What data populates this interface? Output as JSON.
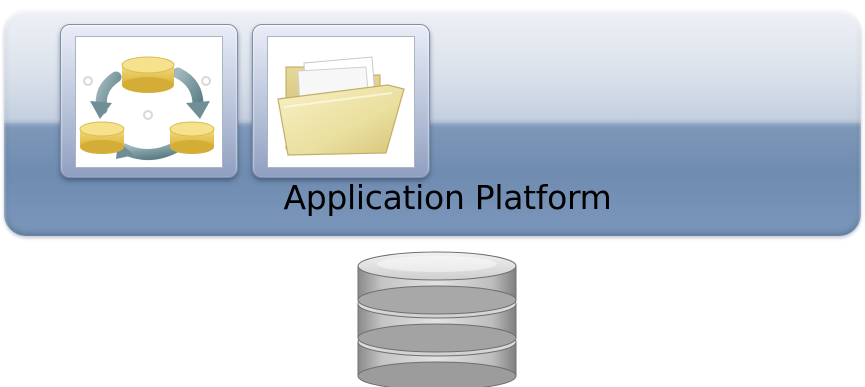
{
  "platform": {
    "title": "Application Platform"
  },
  "icons": [
    "data-sync-cycle-icon",
    "folder-icon",
    "database-icon"
  ],
  "colors": {
    "platform_top": "#d7dfe9",
    "platform_bottom": "#6f8cb0",
    "db_gray": "#c8c8c8",
    "node_yellow": "#e8c64f",
    "arrow_teal": "#7f9fa6"
  }
}
